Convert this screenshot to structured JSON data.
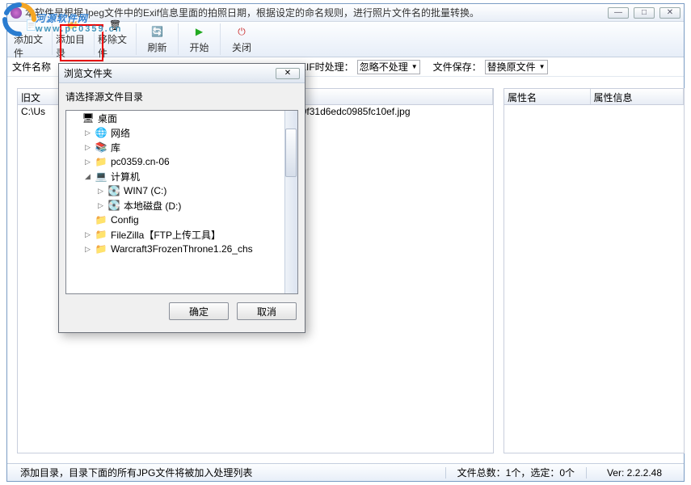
{
  "titlebar": {
    "text": "本软件是根据Jpeg文件中的Exif信息里面的拍照日期，根据设定的命名规则，进行照片文件名的批量转换。",
    "min": "—",
    "max": "□",
    "close": "✕"
  },
  "watermark": {
    "brand": "河源软件网",
    "sub": "www.pc0359.cn"
  },
  "toolbar": {
    "add_file": "添加文件",
    "add_dir": "添加目录",
    "remove": "移除文件",
    "refresh": "刷新",
    "start": "开始",
    "close": "关闭"
  },
  "options": {
    "filename_label": "文件名称",
    "exif_label": "XIF时处理：",
    "exif_value": "忽略不处理",
    "save_label": "文件保存：",
    "save_value": "替换原文件"
  },
  "grid": {
    "col_old": "旧文",
    "row0": "C:\\Us",
    "row0_right": "7d59f31d6edc0985fc10ef.jpg"
  },
  "prop": {
    "col1": "属性名",
    "col2": "属性信息"
  },
  "status": {
    "left": "添加目录，目录下面的所有JPG文件将被加入处理列表",
    "counts": "文件总数：1个，选定：0个",
    "ver": "Ver: 2.2.2.48"
  },
  "dialog": {
    "title": "浏览文件夹",
    "instr": "请选择源文件目录",
    "ok": "确定",
    "cancel": "取消",
    "tree": [
      {
        "indent": 0,
        "exp": "",
        "ico": "🖥",
        "label": "桌面"
      },
      {
        "indent": 1,
        "exp": "▷",
        "ico": "🌐",
        "label": "网络"
      },
      {
        "indent": 1,
        "exp": "▷",
        "ico": "📚",
        "label": "库"
      },
      {
        "indent": 1,
        "exp": "▷",
        "ico": "📁",
        "label": "pc0359.cn-06"
      },
      {
        "indent": 1,
        "exp": "◢",
        "ico": "💻",
        "label": "计算机"
      },
      {
        "indent": 2,
        "exp": "▷",
        "ico": "💽",
        "label": "WIN7 (C:)"
      },
      {
        "indent": 2,
        "exp": "▷",
        "ico": "💽",
        "label": "本地磁盘 (D:)"
      },
      {
        "indent": 1,
        "exp": "",
        "ico": "📁",
        "label": "Config"
      },
      {
        "indent": 1,
        "exp": "▷",
        "ico": "📁",
        "label": "FileZilla【FTP上传工具】"
      },
      {
        "indent": 1,
        "exp": "▷",
        "ico": "📁",
        "label": "Warcraft3FrozenThrone1.26_chs"
      }
    ]
  }
}
